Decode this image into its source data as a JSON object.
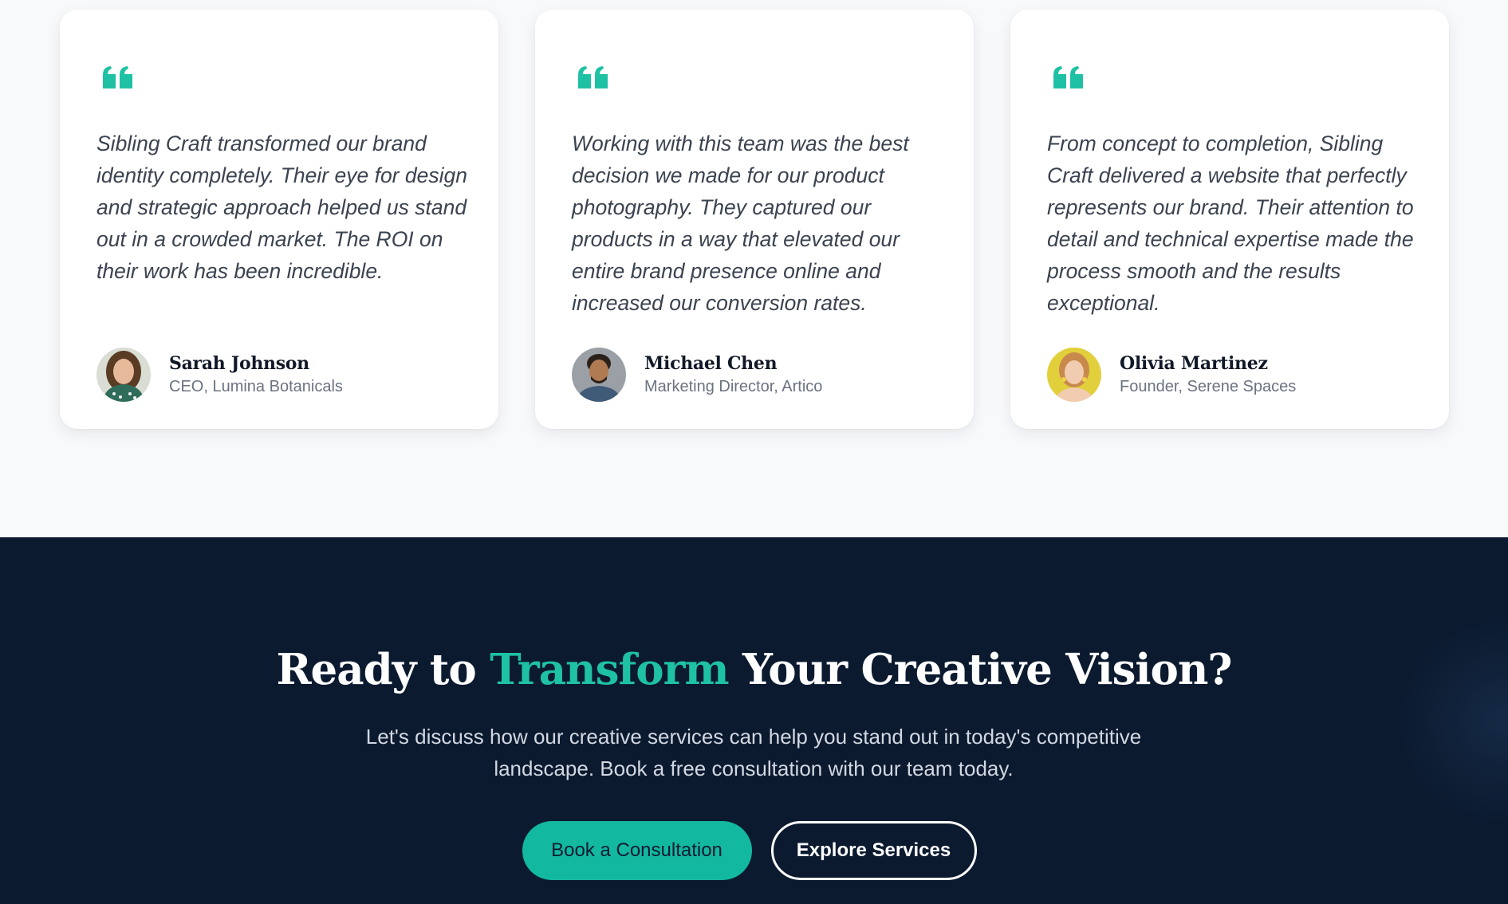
{
  "colors": {
    "accent": "#1fc1a4",
    "primary_button": "#13b8a0",
    "dark_section": "#0b1a2f",
    "page_background": "#f8f9fb"
  },
  "testimonials": [
    {
      "icon": "quote-icon",
      "quote": "Sibling Craft transformed our brand identity completely. Their eye for design and strategic approach helped us stand out in a crowded market. The ROI on their work has been incredible.",
      "name": "Sarah Johnson",
      "role": "CEO, Lumina Botanicals"
    },
    {
      "icon": "quote-icon",
      "quote": "Working with this team was the best decision we made for our product photography. They captured our products in a way that elevated our entire brand presence online and increased our conversion rates.",
      "name": "Michael Chen",
      "role": "Marketing Director, Artico"
    },
    {
      "icon": "quote-icon",
      "quote": "From concept to completion, Sibling Craft delivered a website that perfectly represents our brand. Their attention to detail and technical expertise made the process smooth and the results exceptional.",
      "name": "Olivia Martinez",
      "role": "Founder, Serene Spaces"
    }
  ],
  "cta": {
    "title_before": "Ready to ",
    "title_accent": "Transform",
    "title_after": " Your Creative Vision?",
    "description": "Let's discuss how our creative services can help you stand out in today's competitive landscape. Book a free consultation with our team today.",
    "primary_button": "Book a Consultation",
    "secondary_button": "Explore Services"
  }
}
